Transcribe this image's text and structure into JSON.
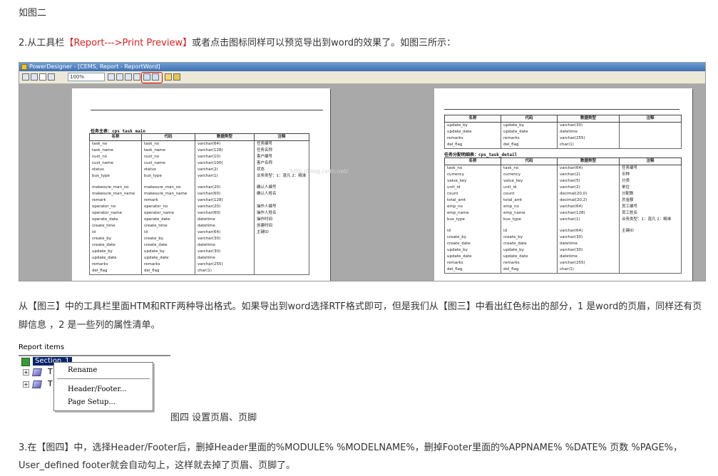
{
  "blocks": {
    "fig2_label": "如图二",
    "step2_prefix": "2.从工具栏",
    "step2_highlight": "【Report--->Print Preview】",
    "step2_suffix": "或者点击图标同样可以预览导出到word的效果了。如图三所示：",
    "explanation_line1": "从【图三】中的工具栏里面HTM和RTF两种导出格式。如果导出到word选择RTF格式即可，但是我们从【图三】中看出红色标出的部分，1 是word的页眉，同样还有页",
    "explanation_line2": "脚信息 ，2 是一些列的属性清单。",
    "fig4_caption": "图四 设置页眉、页脚",
    "step3_line1": "3.在【图四】中，选择Header/Footer后，删掉Header里面的%MODULE% %MODELNAME%，删掉Footer里面的%APPNAME% %DATE% 页数 %PAGE%，",
    "step3_line2": "User_defined footer就会自动勾上，这样就去掉了页眉、页脚了。"
  },
  "powerdesigner": {
    "window_title": "PowerDesigner - [CEMS, Report - ReportWord]",
    "zoom": "100%",
    "page1": {
      "table_title": "任务主表：cps_task_main",
      "headers": [
        "名称",
        "代码",
        "数据类型",
        "注释"
      ],
      "rows": [
        [
          "task_no",
          "task_no",
          "varchar(64)",
          "任务编号"
        ],
        [
          "task_name",
          "task_name",
          "varchar(128)",
          "任务名称"
        ],
        [
          "cust_no",
          "cust_no",
          "varchar(10)",
          "客户编号"
        ],
        [
          "cust_name",
          "cust_name",
          "varchar(100)",
          "客户名称"
        ],
        [
          "status",
          "status",
          "varchar(2)",
          "状态"
        ],
        [
          "bus_type",
          "bus_type",
          "varchar(1)",
          "业务类型：1：混凡 2：精准"
        ],
        [
          "",
          "",
          "",
          ""
        ],
        [
          "makesure_man_no",
          "makesure_man_no",
          "varchar(20)",
          "确认人编号"
        ],
        [
          "makesure_man_name",
          "makesure_man_name",
          "varchar(60)",
          "确认人姓名"
        ],
        [
          "remark",
          "remark",
          "varchar(128)",
          ""
        ],
        [
          "operator_no",
          "operator_no",
          "varchar(20)",
          "操作人编号"
        ],
        [
          "operator_name",
          "operator_name",
          "varchar(60)",
          "操作人姓名"
        ],
        [
          "operate_date",
          "operate_date",
          "datetime",
          "操作时间"
        ],
        [
          "create_time",
          "create_time",
          "datetime",
          "创建时间"
        ],
        [
          "id",
          "id",
          "varchar(64)",
          "主键ID"
        ],
        [
          "create_by",
          "create_by",
          "varchar(30)",
          ""
        ],
        [
          "create_date",
          "create_date",
          "datetime",
          ""
        ],
        [
          "update_by",
          "update_by",
          "varchar(30)",
          ""
        ],
        [
          "update_date",
          "update_date",
          "datetime",
          ""
        ],
        [
          "remarks",
          "remarks",
          "varchar(255)",
          ""
        ],
        [
          "del_flag",
          "del_flag",
          "char(1)",
          ""
        ]
      ]
    },
    "page2": {
      "top_headers": [
        "名称",
        "代码",
        "数据类型",
        "注释"
      ],
      "top_rows": [
        [
          "update_by",
          "update_by",
          "varchar(30)",
          ""
        ],
        [
          "update_date",
          "update_date",
          "datetime",
          ""
        ],
        [
          "remarks",
          "remarks",
          "varchar(255)",
          ""
        ],
        [
          "del_flag",
          "del_flag",
          "char(1)",
          ""
        ]
      ],
      "table_title": "任务分配明细表：cps_task_detail",
      "headers": [
        "名称",
        "代码",
        "数据类型",
        "注释"
      ],
      "rows": [
        [
          "task_no",
          "task_no",
          "varchar(64)",
          "任务编号"
        ],
        [
          "currency",
          "currency",
          "varchar(2)",
          "币种"
        ],
        [
          "value_key",
          "value_key",
          "varchar(5)",
          "分类"
        ],
        [
          "unit_id",
          "unit_id",
          "varchar(2)",
          "单位"
        ],
        [
          "count",
          "count",
          "decimal(20,0)",
          "分配数"
        ],
        [
          "total_amt",
          "total_amt",
          "decimal(20,2)",
          "总金额"
        ],
        [
          "emp_no",
          "emp_no",
          "varchar(64)",
          "员工编号"
        ],
        [
          "emp_name",
          "emp_name",
          "varchar(128)",
          "员工姓名"
        ],
        [
          "bus_type",
          "bus_type",
          "varchar(1)",
          "业务类型：1：混凡 2：精准"
        ],
        [
          "",
          "",
          "",
          ""
        ],
        [
          "id",
          "id",
          "varchar(64)",
          "主键ID"
        ],
        [
          "create_by",
          "create_by",
          "varchar(30)",
          ""
        ],
        [
          "create_date",
          "create_date",
          "datetime",
          ""
        ],
        [
          "update_by",
          "update_by",
          "varchar(30)",
          ""
        ],
        [
          "update_date",
          "update_date",
          "datetime",
          ""
        ],
        [
          "remarks",
          "remarks",
          "varchar(255)",
          ""
        ],
        [
          "del_flag",
          "del_flag",
          "char(1)",
          ""
        ]
      ]
    }
  },
  "report_items": {
    "header": "Report items",
    "section_label": "Section_1",
    "child_initial": "T",
    "context_menu": [
      "Rename",
      "Header/Footer...",
      "Page Setup..."
    ]
  }
}
